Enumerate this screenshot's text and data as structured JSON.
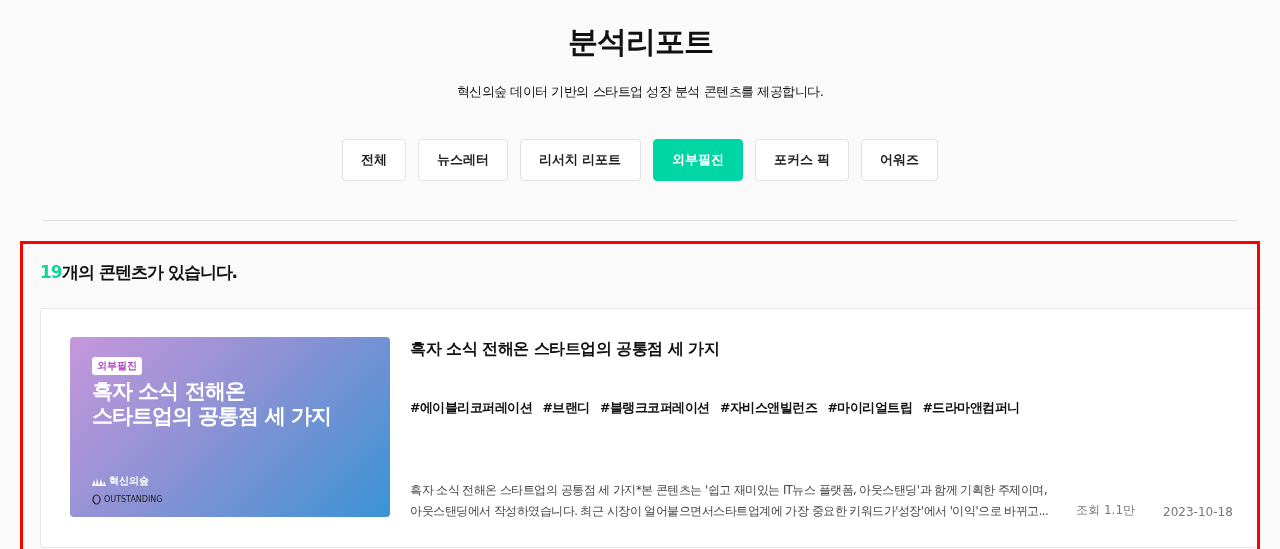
{
  "header": {
    "title": "분석리포트",
    "subtitle": "혁신의숲 데이터 기반의 스타트업 성장 분석 콘텐츠를 제공합니다."
  },
  "tabs": [
    {
      "label": "전체",
      "selected": false
    },
    {
      "label": "뉴스레터",
      "selected": false
    },
    {
      "label": "리서치 리포트",
      "selected": false
    },
    {
      "label": "외부필진",
      "selected": true
    },
    {
      "label": "포커스 픽",
      "selected": false
    },
    {
      "label": "어워즈",
      "selected": false
    }
  ],
  "results": {
    "count": "19",
    "count_suffix": "개의 콘텐츠가 있습니다.",
    "highlighted": true
  },
  "articles": [
    {
      "thumbnail": {
        "badge": "외부필진",
        "title_lines": [
          "흑자 소식 전해온",
          "스타트업의 공통점 세 가지"
        ],
        "brand": "혁신의숲",
        "partner": "OUTSTANDING"
      },
      "title": "흑자 소식 전해온 스타트업의 공통점 세 가지",
      "tags": [
        "#에이블리코퍼레이션",
        "#브랜디",
        "#블랭크코퍼레이션",
        "#자비스앤빌런즈",
        "#마이리얼트립",
        "#드라마앤컴퍼니"
      ],
      "description_lines": [
        "흑자 소식 전해온 스타트업의 공통점 세 가지*본 콘텐츠는 '쉽고 재미있는 IT뉴스 플랫폼, 아웃스탠딩'과 함께 기획한 주제이며,",
        "아웃스탠딩에서 작성하였습니다. 최근 시장이 얼어붙으면서스타트업계에 가장 중요한 키워드가'성장'에서 '이익'으로 바뀌고..."
      ],
      "views": "조회 1.1만",
      "date": "2023-10-18"
    }
  ]
}
